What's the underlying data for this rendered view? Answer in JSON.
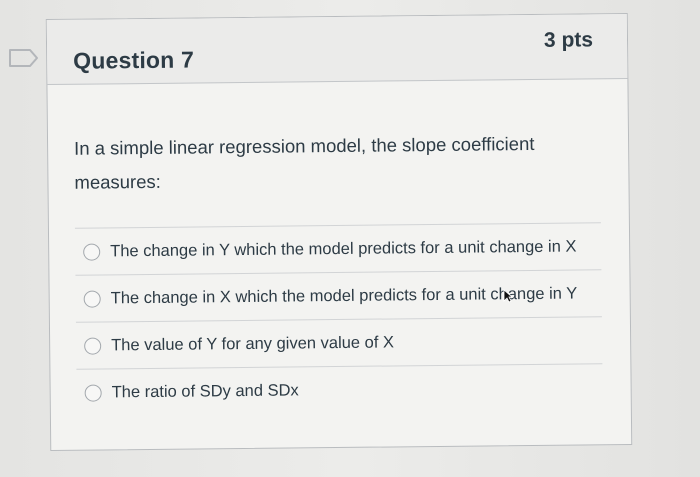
{
  "question": {
    "title": "Question 7",
    "points": "3 pts",
    "text": "In a simple linear regression model, the slope coefficient measures:",
    "answers": [
      {
        "label": "The change in Y which the model predicts for a unit change in X",
        "selected": false
      },
      {
        "label": "The change in X which the model predicts for a unit change in Y",
        "selected": false
      },
      {
        "label": "The value of Y for any given value of X",
        "selected": false
      },
      {
        "label": "The ratio of SDy and SDx",
        "selected": false
      }
    ]
  },
  "icons": {
    "flag": "bookmark-flag-icon",
    "cursor": "mouse-pointer-icon"
  },
  "colors": {
    "text": "#2d3b45",
    "card_bg": "#f3f3f1",
    "header_bg": "#ebebea",
    "border": "#b9bcbf",
    "page_bg": "#e9e9e7"
  }
}
